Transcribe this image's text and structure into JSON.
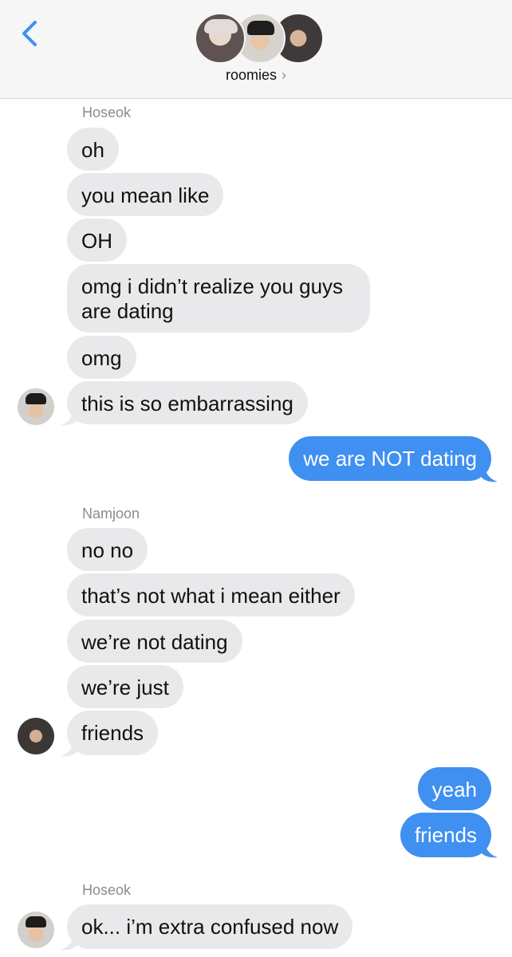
{
  "header": {
    "back_icon": "chevron-left-icon",
    "title": "roomies",
    "chevron": "›",
    "accent_color": "#3f90f0"
  },
  "messages": [
    {
      "sender": "Hoseok"
    },
    {
      "text": "oh"
    },
    {
      "text": "you mean like"
    },
    {
      "text": "OH"
    },
    {
      "text": "omg i didn’t realize you guys are dating"
    },
    {
      "text": "omg"
    },
    {
      "text": "this is so embarrassing"
    },
    {
      "text": "we are NOT dating"
    },
    {
      "sender": "Namjoon"
    },
    {
      "text": "no no"
    },
    {
      "text": "that’s not what i mean either"
    },
    {
      "text": "we’re not dating"
    },
    {
      "text": "we’re just"
    },
    {
      "text": "friends"
    },
    {
      "text": "yeah"
    },
    {
      "text": "friends"
    },
    {
      "sender": "Hoseok"
    },
    {
      "text": "ok... i’m extra confused now"
    }
  ]
}
